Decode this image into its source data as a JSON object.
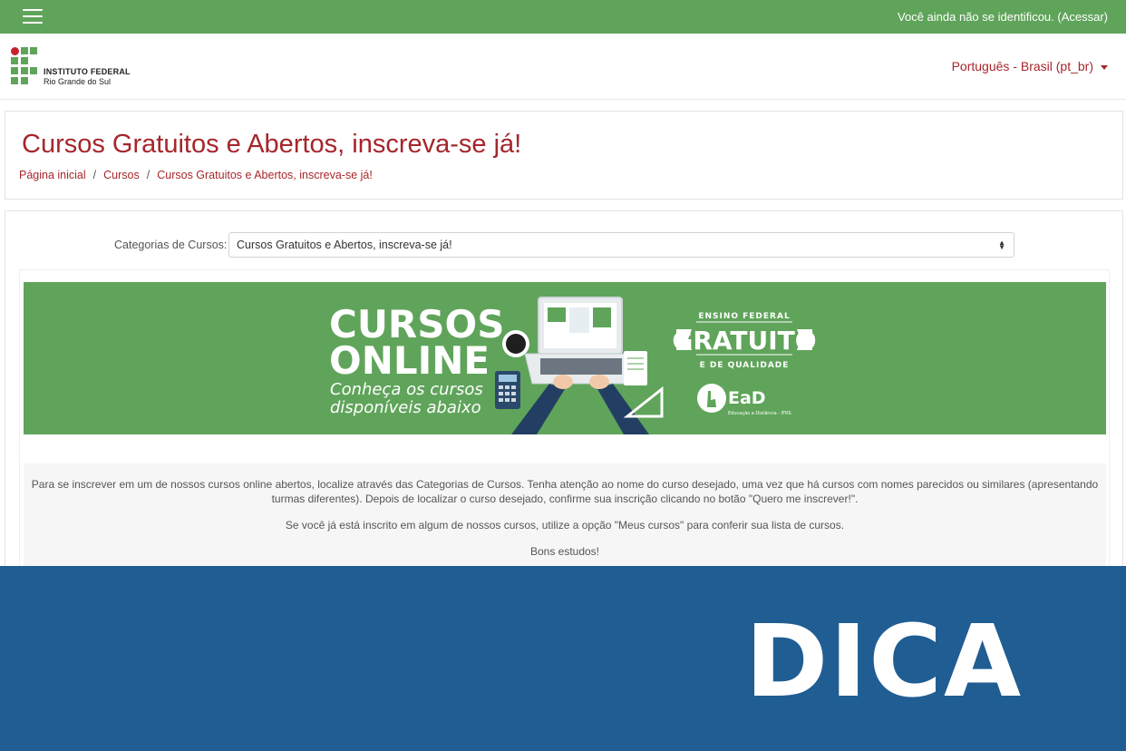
{
  "topbar": {
    "menu_icon": "hamburger-icon",
    "login_text": "Você ainda não se identificou. (Acessar)"
  },
  "header": {
    "logo": {
      "line1": "INSTITUTO FEDERAL",
      "line2": "Rio Grande do Sul"
    },
    "language": "Português - Brasil (pt_br)"
  },
  "page": {
    "title": "Cursos Gratuitos e Abertos, inscreva-se já!",
    "breadcrumb": [
      "Página inicial",
      "Cursos",
      "Cursos Gratuitos e Abertos, inscreva-se já!"
    ]
  },
  "categories": {
    "label": "Categorias de Cursos:",
    "selected": "Cursos Gratuitos e Abertos, inscreva-se já!"
  },
  "banner": {
    "title1": "CURSOS",
    "title2": "ONLINE",
    "subtitle1": "Conheça os cursos",
    "subtitle2": "disponíveis abaixo",
    "right_top": "ENSINO FEDERAL",
    "right_main": "GRATUITO",
    "right_bottom": "E DE QUALIDADE",
    "ead": "EaD",
    "ead_sub": "Educação a Distância - IFRS"
  },
  "info": {
    "p1": "Para se inscrever em um de nossos cursos online abertos, localize através das Categorias de Cursos. Tenha atenção ao nome do curso desejado, uma vez que há cursos com nomes parecidos ou similares (apresentando turmas diferentes). Depois de localizar o curso desejado, confirme sua inscrição clicando no botão \"Quero me inscrever!\".",
    "p2": "Se você já está inscrito em algum de nossos cursos, utilize a opção \"Meus cursos\" para conferir sua lista de cursos.",
    "p3": "Bons estudos!"
  },
  "overlay": {
    "dica": "DICA"
  },
  "colors": {
    "green": "#5fa45a",
    "red": "#a6262b",
    "blue": "#205d93"
  }
}
